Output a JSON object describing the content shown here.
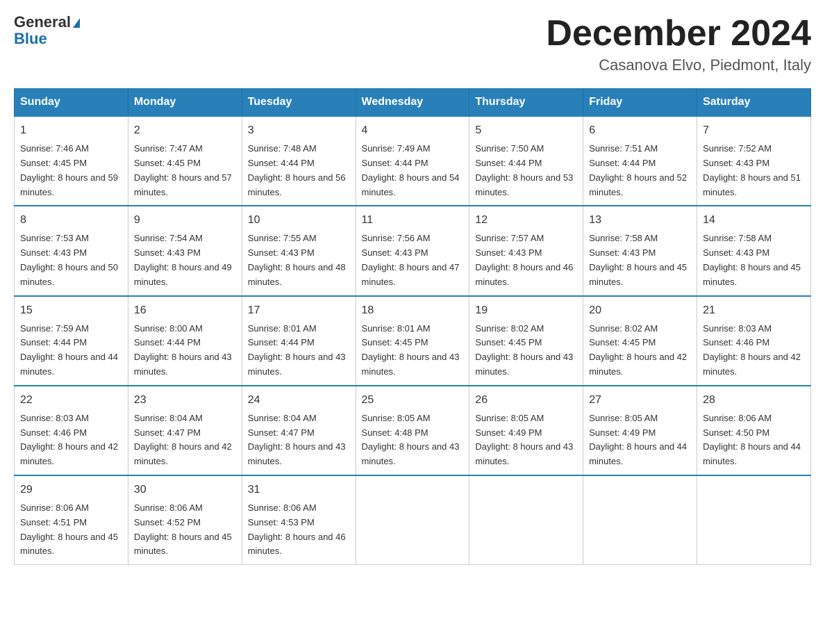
{
  "header": {
    "logo_line1": "General",
    "logo_line2": "Blue",
    "month_title": "December 2024",
    "location": "Casanova Elvo, Piedmont, Italy"
  },
  "days_of_week": [
    "Sunday",
    "Monday",
    "Tuesday",
    "Wednesday",
    "Thursday",
    "Friday",
    "Saturday"
  ],
  "weeks": [
    [
      {
        "day": "1",
        "sunrise": "7:46 AM",
        "sunset": "4:45 PM",
        "daylight": "8 hours and 59 minutes."
      },
      {
        "day": "2",
        "sunrise": "7:47 AM",
        "sunset": "4:45 PM",
        "daylight": "8 hours and 57 minutes."
      },
      {
        "day": "3",
        "sunrise": "7:48 AM",
        "sunset": "4:44 PM",
        "daylight": "8 hours and 56 minutes."
      },
      {
        "day": "4",
        "sunrise": "7:49 AM",
        "sunset": "4:44 PM",
        "daylight": "8 hours and 54 minutes."
      },
      {
        "day": "5",
        "sunrise": "7:50 AM",
        "sunset": "4:44 PM",
        "daylight": "8 hours and 53 minutes."
      },
      {
        "day": "6",
        "sunrise": "7:51 AM",
        "sunset": "4:44 PM",
        "daylight": "8 hours and 52 minutes."
      },
      {
        "day": "7",
        "sunrise": "7:52 AM",
        "sunset": "4:43 PM",
        "daylight": "8 hours and 51 minutes."
      }
    ],
    [
      {
        "day": "8",
        "sunrise": "7:53 AM",
        "sunset": "4:43 PM",
        "daylight": "8 hours and 50 minutes."
      },
      {
        "day": "9",
        "sunrise": "7:54 AM",
        "sunset": "4:43 PM",
        "daylight": "8 hours and 49 minutes."
      },
      {
        "day": "10",
        "sunrise": "7:55 AM",
        "sunset": "4:43 PM",
        "daylight": "8 hours and 48 minutes."
      },
      {
        "day": "11",
        "sunrise": "7:56 AM",
        "sunset": "4:43 PM",
        "daylight": "8 hours and 47 minutes."
      },
      {
        "day": "12",
        "sunrise": "7:57 AM",
        "sunset": "4:43 PM",
        "daylight": "8 hours and 46 minutes."
      },
      {
        "day": "13",
        "sunrise": "7:58 AM",
        "sunset": "4:43 PM",
        "daylight": "8 hours and 45 minutes."
      },
      {
        "day": "14",
        "sunrise": "7:58 AM",
        "sunset": "4:43 PM",
        "daylight": "8 hours and 45 minutes."
      }
    ],
    [
      {
        "day": "15",
        "sunrise": "7:59 AM",
        "sunset": "4:44 PM",
        "daylight": "8 hours and 44 minutes."
      },
      {
        "day": "16",
        "sunrise": "8:00 AM",
        "sunset": "4:44 PM",
        "daylight": "8 hours and 43 minutes."
      },
      {
        "day": "17",
        "sunrise": "8:01 AM",
        "sunset": "4:44 PM",
        "daylight": "8 hours and 43 minutes."
      },
      {
        "day": "18",
        "sunrise": "8:01 AM",
        "sunset": "4:45 PM",
        "daylight": "8 hours and 43 minutes."
      },
      {
        "day": "19",
        "sunrise": "8:02 AM",
        "sunset": "4:45 PM",
        "daylight": "8 hours and 43 minutes."
      },
      {
        "day": "20",
        "sunrise": "8:02 AM",
        "sunset": "4:45 PM",
        "daylight": "8 hours and 42 minutes."
      },
      {
        "day": "21",
        "sunrise": "8:03 AM",
        "sunset": "4:46 PM",
        "daylight": "8 hours and 42 minutes."
      }
    ],
    [
      {
        "day": "22",
        "sunrise": "8:03 AM",
        "sunset": "4:46 PM",
        "daylight": "8 hours and 42 minutes."
      },
      {
        "day": "23",
        "sunrise": "8:04 AM",
        "sunset": "4:47 PM",
        "daylight": "8 hours and 42 minutes."
      },
      {
        "day": "24",
        "sunrise": "8:04 AM",
        "sunset": "4:47 PM",
        "daylight": "8 hours and 43 minutes."
      },
      {
        "day": "25",
        "sunrise": "8:05 AM",
        "sunset": "4:48 PM",
        "daylight": "8 hours and 43 minutes."
      },
      {
        "day": "26",
        "sunrise": "8:05 AM",
        "sunset": "4:49 PM",
        "daylight": "8 hours and 43 minutes."
      },
      {
        "day": "27",
        "sunrise": "8:05 AM",
        "sunset": "4:49 PM",
        "daylight": "8 hours and 44 minutes."
      },
      {
        "day": "28",
        "sunrise": "8:06 AM",
        "sunset": "4:50 PM",
        "daylight": "8 hours and 44 minutes."
      }
    ],
    [
      {
        "day": "29",
        "sunrise": "8:06 AM",
        "sunset": "4:51 PM",
        "daylight": "8 hours and 45 minutes."
      },
      {
        "day": "30",
        "sunrise": "8:06 AM",
        "sunset": "4:52 PM",
        "daylight": "8 hours and 45 minutes."
      },
      {
        "day": "31",
        "sunrise": "8:06 AM",
        "sunset": "4:53 PM",
        "daylight": "8 hours and 46 minutes."
      },
      null,
      null,
      null,
      null
    ]
  ]
}
